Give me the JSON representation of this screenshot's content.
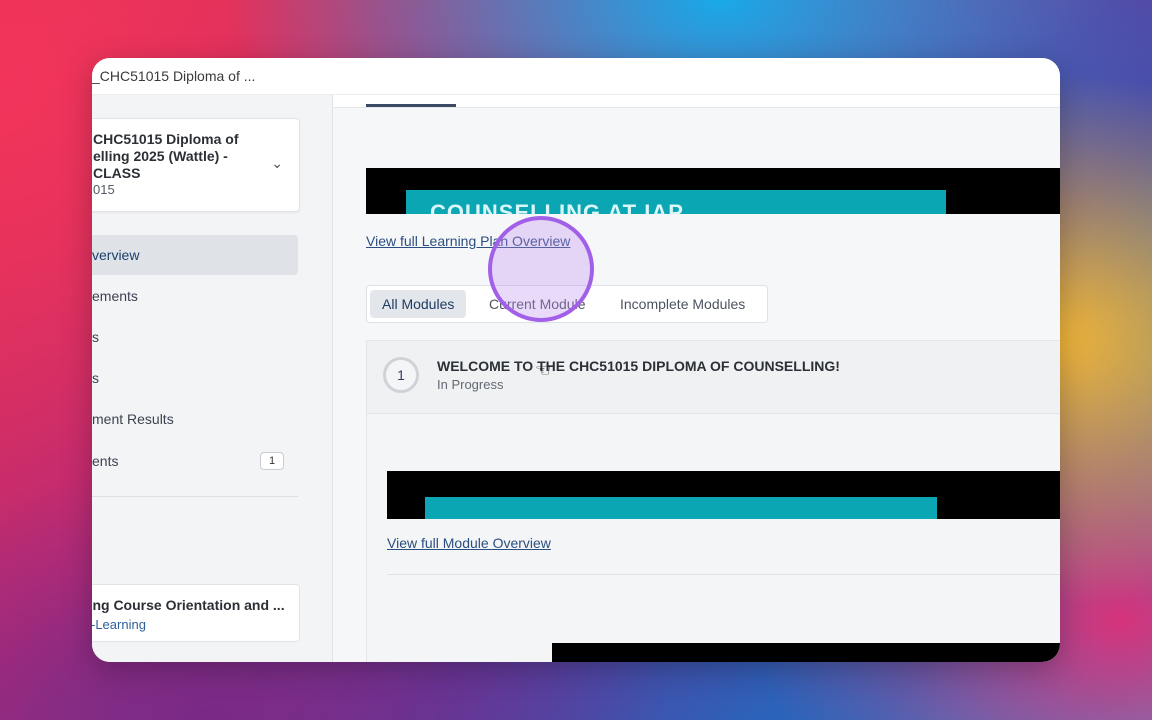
{
  "window": {
    "title": "_CHC51015 Diploma of ..."
  },
  "sidebar": {
    "course": {
      "title": "CHC51015 Diploma of elling 2025 (Wattle) - CLASS",
      "title_lines": [
        "CHC51015 Diploma of",
        "elling 2025 (Wattle) -",
        "CLASS"
      ],
      "code": "015"
    },
    "items": [
      {
        "label": "verview",
        "active": true
      },
      {
        "label": "ements"
      },
      {
        "label": "s"
      },
      {
        "label": "s"
      },
      {
        "label": "ment Results"
      },
      {
        "label": "ents",
        "badge": "1"
      }
    ],
    "enrollment": {
      "title": "elling Course Orientation and ...",
      "subtitle": "-Learning"
    }
  },
  "main": {
    "banner_text": "COUNSELLING AT IAP",
    "overview_link": "View full Learning Plan Overview",
    "tabs": [
      {
        "label": "All Modules",
        "active": true
      },
      {
        "label": "Current Module"
      },
      {
        "label": "Incomplete Modules"
      }
    ],
    "module": {
      "number": "1",
      "title": "WELCOME TO THE CHC51015 DIPLOMA OF COUNSELLING!",
      "status": "In Progress",
      "link": "View full Module Overview"
    }
  },
  "colors": {
    "accent": "#a260e8",
    "teal": "#0aa6b3",
    "link": "#2a4e7f"
  }
}
